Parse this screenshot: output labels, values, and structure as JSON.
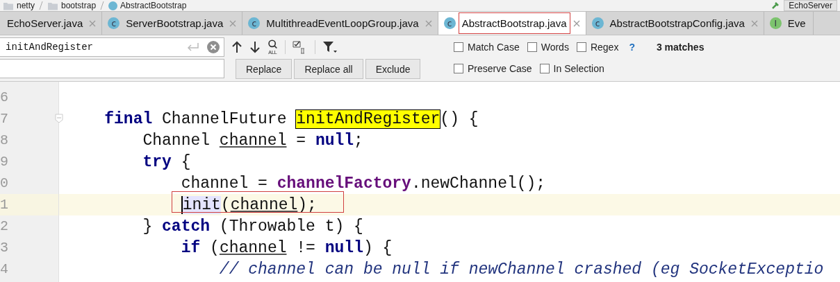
{
  "breadcrumb": {
    "items": [
      {
        "label": "netty",
        "kind": "folder"
      },
      {
        "label": "bootstrap",
        "kind": "folder"
      },
      {
        "label": "AbstractBootstrap",
        "kind": "class"
      }
    ],
    "run_config": "EchoServer"
  },
  "tabs": [
    {
      "label": "EchoServer.java",
      "selected": false
    },
    {
      "label": "ServerBootstrap.java",
      "selected": false,
      "icon": {
        "letter": "c",
        "color": "#6cb6d3"
      }
    },
    {
      "label": "MultithreadEventLoopGroup.java",
      "selected": false,
      "icon": {
        "letter": "c",
        "color": "#6cb6d3"
      }
    },
    {
      "label": "AbstractBootstrap.java",
      "selected": true,
      "icon": {
        "letter": "c",
        "color": "#6cb6d3"
      }
    },
    {
      "label": "AbstractBootstrapConfig.java",
      "selected": false,
      "icon": {
        "letter": "c",
        "color": "#6cb6d3"
      }
    },
    {
      "label": "Eve",
      "selected": false,
      "icon": {
        "letter": "I",
        "color": "#7cc36e"
      }
    }
  ],
  "find": {
    "search": {
      "value": "initAndRegister"
    },
    "find_all_label": "ALL",
    "buttons": [
      "Replace",
      "Replace all",
      "Exclude"
    ],
    "options_row_1": [
      {
        "label": "Match Case",
        "checked": false
      },
      {
        "label": "Words",
        "checked": false
      },
      {
        "label": "Regex",
        "checked": false
      }
    ],
    "options_row_2": [
      {
        "label": "Preserve Case",
        "checked": false
      },
      {
        "label": "In Selection",
        "checked": false
      }
    ],
    "help": "?",
    "match_count": "3 matches"
  },
  "editor": {
    "lines": [
      {
        "number": "6",
        "current": false
      },
      {
        "number": "7",
        "current": false,
        "tokens": [
          {
            "text": "    final",
            "kind": "keyword"
          },
          {
            "text": " ChannelFuture ",
            "kind": "plain"
          },
          {
            "text": "initAndRegister",
            "kind": "match"
          },
          {
            "text": "() {",
            "kind": "plain"
          }
        ]
      },
      {
        "number": "8",
        "current": false,
        "tokens": [
          {
            "text": "        Channel ",
            "kind": "plain"
          },
          {
            "text": "channel",
            "kind": "local"
          },
          {
            "text": " = ",
            "kind": "plain"
          },
          {
            "text": "null",
            "kind": "keyword"
          },
          {
            "text": ";",
            "kind": "plain"
          }
        ]
      },
      {
        "number": "9",
        "current": false,
        "tokens": [
          {
            "text": "        try",
            "kind": "keyword"
          },
          {
            "text": " {",
            "kind": "plain"
          }
        ]
      },
      {
        "number": "0",
        "current": false,
        "tokens": [
          {
            "text": "            channel = ",
            "kind": "plain"
          },
          {
            "text": "channelFactory",
            "kind": "field"
          },
          {
            "text": ".newChannel();",
            "kind": "plain"
          }
        ]
      },
      {
        "number": "1",
        "current": true,
        "tokens": [
          {
            "text": "            init",
            "kind": "caret"
          },
          {
            "text": "(",
            "kind": "plain"
          },
          {
            "text": "channel",
            "kind": "local"
          },
          {
            "text": ");",
            "kind": "plain"
          }
        ]
      },
      {
        "number": "2",
        "current": false,
        "tokens": [
          {
            "text": "        } ",
            "kind": "plain"
          },
          {
            "text": "catch",
            "kind": "keyword"
          },
          {
            "text": " (Throwable t) {",
            "kind": "plain"
          }
        ]
      },
      {
        "number": "3",
        "current": false,
        "tokens": [
          {
            "text": "            if",
            "kind": "keyword"
          },
          {
            "text": " (",
            "kind": "plain"
          },
          {
            "text": "channel",
            "kind": "local"
          },
          {
            "text": " != ",
            "kind": "plain"
          },
          {
            "text": "null",
            "kind": "keyword"
          },
          {
            "text": ") {",
            "kind": "plain"
          }
        ]
      },
      {
        "number": "4",
        "current": false,
        "tokens": [
          {
            "text": "                // channel can be null if newChannel crashed (eg SocketExceptio",
            "kind": "comment"
          }
        ]
      }
    ]
  }
}
